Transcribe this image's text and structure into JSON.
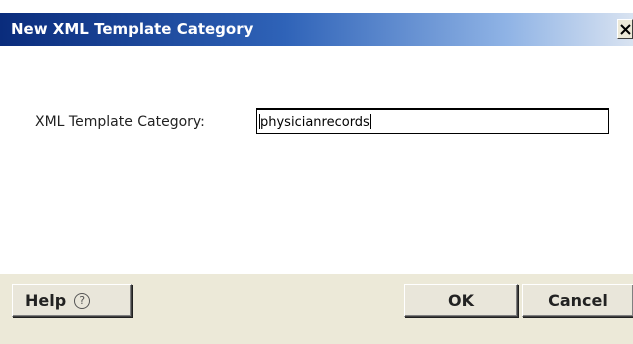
{
  "window": {
    "title": "New XML Template Category",
    "close_glyph": "×"
  },
  "form": {
    "category_label": "XML Template Category:",
    "category_value": "physicianrecords"
  },
  "buttons": {
    "help_label": "Help",
    "help_icon_glyph": "?",
    "ok_label": "OK",
    "cancel_label": "Cancel"
  },
  "colors": {
    "titlebar_start": "#0a2c7c",
    "titlebar_end": "#d9e3f1",
    "footer_bg": "#ece9d8"
  }
}
